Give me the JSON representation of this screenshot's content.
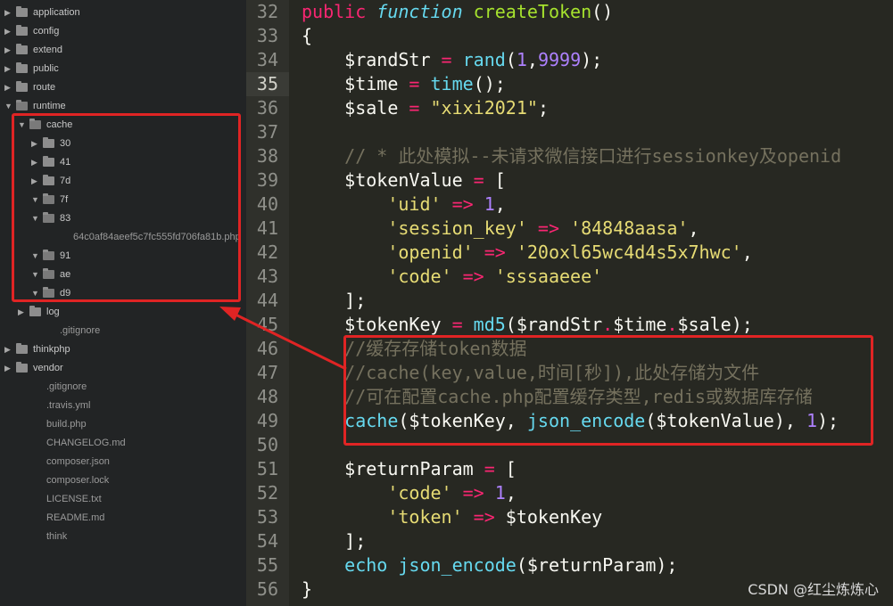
{
  "sidebar": {
    "items": [
      {
        "label": "application",
        "kind": "folder",
        "state": "closed",
        "depth": 0,
        "row": 0
      },
      {
        "label": "config",
        "kind": "folder",
        "state": "closed",
        "depth": 0,
        "row": 1
      },
      {
        "label": "extend",
        "kind": "folder",
        "state": "closed",
        "depth": 0,
        "row": 2
      },
      {
        "label": "public",
        "kind": "folder",
        "state": "closed",
        "depth": 0,
        "row": 3
      },
      {
        "label": "route",
        "kind": "folder",
        "state": "closed",
        "depth": 0,
        "row": 4
      },
      {
        "label": "runtime",
        "kind": "folder",
        "state": "open",
        "depth": 0,
        "row": 5
      },
      {
        "label": "cache",
        "kind": "folder",
        "state": "open",
        "depth": 1,
        "row": 6
      },
      {
        "label": "30",
        "kind": "folder",
        "state": "closed",
        "depth": 2,
        "row": 7
      },
      {
        "label": "41",
        "kind": "folder",
        "state": "closed",
        "depth": 2,
        "row": 8
      },
      {
        "label": "7d",
        "kind": "folder",
        "state": "closed",
        "depth": 2,
        "row": 9
      },
      {
        "label": "7f",
        "kind": "folder",
        "state": "open",
        "depth": 2,
        "row": 10
      },
      {
        "label": "83",
        "kind": "folder",
        "state": "open",
        "depth": 2,
        "row": 11
      },
      {
        "label": "64c0af84aeef5c7fc555fd706fa81b.php",
        "kind": "file",
        "depth": 3,
        "row": 12
      },
      {
        "label": "91",
        "kind": "folder",
        "state": "open",
        "depth": 2,
        "row": 13
      },
      {
        "label": "ae",
        "kind": "folder",
        "state": "open",
        "depth": 2,
        "row": 14
      },
      {
        "label": "d9",
        "kind": "folder",
        "state": "open",
        "depth": 2,
        "row": 15
      },
      {
        "label": "log",
        "kind": "folder",
        "state": "closed",
        "depth": 1,
        "row": 16
      },
      {
        "label": ".gitignore",
        "kind": "file",
        "depth": 2,
        "row": 17
      },
      {
        "label": "thinkphp",
        "kind": "folder",
        "state": "closed",
        "depth": 0,
        "row": 18
      },
      {
        "label": "vendor",
        "kind": "folder",
        "state": "closed",
        "depth": 0,
        "row": 19
      },
      {
        "label": ".gitignore",
        "kind": "file",
        "depth": 1,
        "row": 20
      },
      {
        "label": ".travis.yml",
        "kind": "file",
        "depth": 1,
        "row": 21
      },
      {
        "label": "build.php",
        "kind": "file",
        "depth": 1,
        "row": 22
      },
      {
        "label": "CHANGELOG.md",
        "kind": "file",
        "depth": 1,
        "row": 23
      },
      {
        "label": "composer.json",
        "kind": "file",
        "depth": 1,
        "row": 24
      },
      {
        "label": "composer.lock",
        "kind": "file",
        "depth": 1,
        "row": 25
      },
      {
        "label": "LICENSE.txt",
        "kind": "file",
        "depth": 1,
        "row": 26
      },
      {
        "label": "README.md",
        "kind": "file",
        "depth": 1,
        "row": 27
      },
      {
        "label": "think",
        "kind": "file",
        "depth": 1,
        "row": 28
      }
    ]
  },
  "editor": {
    "active_line": 35,
    "lines": [
      {
        "num": "32",
        "tokens": [
          [
            "k",
            "public "
          ],
          [
            "fi",
            "function "
          ],
          [
            "f",
            "createToken"
          ],
          [
            "v",
            "()"
          ]
        ]
      },
      {
        "num": "33",
        "tokens": [
          [
            "v",
            "{"
          ]
        ]
      },
      {
        "num": "34",
        "tokens": [
          [
            "v",
            "    $randStr "
          ],
          [
            "k",
            "="
          ],
          [
            "v",
            " "
          ],
          [
            "b",
            "rand"
          ],
          [
            "v",
            "("
          ],
          [
            "n",
            "1"
          ],
          [
            "v",
            ","
          ],
          [
            "n",
            "9999"
          ],
          [
            "v",
            ");"
          ]
        ]
      },
      {
        "num": "35",
        "tokens": [
          [
            "v",
            "    $time "
          ],
          [
            "k",
            "="
          ],
          [
            "v",
            " "
          ],
          [
            "b",
            "time"
          ],
          [
            "v",
            "();"
          ]
        ]
      },
      {
        "num": "36",
        "tokens": [
          [
            "v",
            "    $sale "
          ],
          [
            "k",
            "="
          ],
          [
            "v",
            " "
          ],
          [
            "s",
            "\"xixi2021\""
          ],
          [
            "v",
            ";"
          ]
        ]
      },
      {
        "num": "37",
        "tokens": []
      },
      {
        "num": "38",
        "tokens": [
          [
            "c",
            "    // * 此处模拟--未请求微信接口进行sessionkey及openid"
          ]
        ]
      },
      {
        "num": "39",
        "tokens": [
          [
            "v",
            "    $tokenValue "
          ],
          [
            "k",
            "="
          ],
          [
            "v",
            " ["
          ]
        ]
      },
      {
        "num": "40",
        "tokens": [
          [
            "v",
            "        "
          ],
          [
            "s",
            "'uid'"
          ],
          [
            "v",
            " "
          ],
          [
            "k",
            "=>"
          ],
          [
            "v",
            " "
          ],
          [
            "n",
            "1"
          ],
          [
            "v",
            ","
          ]
        ]
      },
      {
        "num": "41",
        "tokens": [
          [
            "v",
            "        "
          ],
          [
            "s",
            "'session_key'"
          ],
          [
            "v",
            " "
          ],
          [
            "k",
            "=>"
          ],
          [
            "v",
            " "
          ],
          [
            "s",
            "'84848aasa'"
          ],
          [
            "v",
            ","
          ]
        ]
      },
      {
        "num": "42",
        "tokens": [
          [
            "v",
            "        "
          ],
          [
            "s",
            "'openid'"
          ],
          [
            "v",
            " "
          ],
          [
            "k",
            "=>"
          ],
          [
            "v",
            " "
          ],
          [
            "s",
            "'20oxl65wc4d4s5x7hwc'"
          ],
          [
            "v",
            ","
          ]
        ]
      },
      {
        "num": "43",
        "tokens": [
          [
            "v",
            "        "
          ],
          [
            "s",
            "'code'"
          ],
          [
            "v",
            " "
          ],
          [
            "k",
            "=>"
          ],
          [
            "v",
            " "
          ],
          [
            "s",
            "'sssaaeee'"
          ]
        ]
      },
      {
        "num": "44",
        "tokens": [
          [
            "v",
            "    ];"
          ]
        ]
      },
      {
        "num": "45",
        "tokens": [
          [
            "v",
            "    $tokenKey "
          ],
          [
            "k",
            "="
          ],
          [
            "v",
            " "
          ],
          [
            "b",
            "md5"
          ],
          [
            "v",
            "($randStr"
          ],
          [
            "k",
            "."
          ],
          [
            "v",
            "$time"
          ],
          [
            "k",
            "."
          ],
          [
            "v",
            "$sale);"
          ]
        ]
      },
      {
        "num": "46",
        "tokens": [
          [
            "c",
            "    //缓存存储token数据"
          ]
        ]
      },
      {
        "num": "47",
        "tokens": [
          [
            "c",
            "    //cache(key,value,时间[秒]),此处存储为文件"
          ]
        ]
      },
      {
        "num": "48",
        "tokens": [
          [
            "c",
            "    //可在配置cache.php配置缓存类型,redis或数据库存储"
          ]
        ]
      },
      {
        "num": "49",
        "tokens": [
          [
            "v",
            "    "
          ],
          [
            "b",
            "cache"
          ],
          [
            "v",
            "($tokenKey, "
          ],
          [
            "b",
            "json_encode"
          ],
          [
            "v",
            "($tokenValue), "
          ],
          [
            "n",
            "1"
          ],
          [
            "v",
            ");"
          ]
        ]
      },
      {
        "num": "50",
        "tokens": []
      },
      {
        "num": "51",
        "tokens": [
          [
            "v",
            "    $returnParam "
          ],
          [
            "k",
            "="
          ],
          [
            "v",
            " ["
          ]
        ]
      },
      {
        "num": "52",
        "tokens": [
          [
            "v",
            "        "
          ],
          [
            "s",
            "'code'"
          ],
          [
            "v",
            " "
          ],
          [
            "k",
            "=>"
          ],
          [
            "v",
            " "
          ],
          [
            "n",
            "1"
          ],
          [
            "v",
            ","
          ]
        ]
      },
      {
        "num": "53",
        "tokens": [
          [
            "v",
            "        "
          ],
          [
            "s",
            "'token'"
          ],
          [
            "v",
            " "
          ],
          [
            "k",
            "=>"
          ],
          [
            "v",
            " $tokenKey"
          ]
        ]
      },
      {
        "num": "54",
        "tokens": [
          [
            "v",
            "    ];"
          ]
        ]
      },
      {
        "num": "55",
        "tokens": [
          [
            "v",
            "    "
          ],
          [
            "b",
            "echo"
          ],
          [
            "v",
            " "
          ],
          [
            "b",
            "json_encode"
          ],
          [
            "v",
            "($returnParam);"
          ]
        ]
      },
      {
        "num": "56",
        "tokens": [
          [
            "v",
            "}"
          ]
        ]
      }
    ]
  },
  "watermark": "CSDN @红尘炼炼心",
  "colors": {
    "highlight_box": "#e02424",
    "editor_bg": "#272822",
    "sidebar_bg": "#222425"
  }
}
